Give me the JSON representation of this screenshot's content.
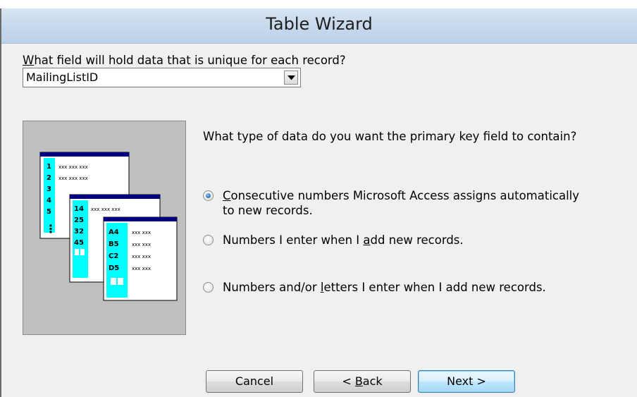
{
  "window": {
    "title": "Table Wizard"
  },
  "unique_field": {
    "question_prefix": "W",
    "question_rest": "hat field will hold data that is unique for each record?",
    "selected_value": "MailingListID"
  },
  "primary_key": {
    "question": "What type of data do you want the primary key field to contain?",
    "options": [
      {
        "label_prefix": "",
        "label_access": "C",
        "label_rest": "onsecutive numbers Microsoft Access assigns automatically",
        "label_line2": "to new records.",
        "checked": true
      },
      {
        "label_prefix": "Numbers I enter when I ",
        "label_access": "a",
        "label_rest": "dd new records.",
        "label_line2": "",
        "checked": false
      },
      {
        "label_prefix": "Numbers and/or ",
        "label_access": "l",
        "label_rest": "etters I enter when I add new records.",
        "label_line2": "",
        "checked": false
      }
    ]
  },
  "illustration": {
    "table1_rows": [
      "1",
      "2",
      "3",
      "4",
      "5"
    ],
    "table1_cells": "xxx xxx xxx",
    "table2_rows": [
      "14",
      "25",
      "32",
      "45"
    ],
    "table2_cells": "xxx xxx xxx",
    "table3_rows": [
      "A4",
      "B5",
      "C2",
      "D5"
    ],
    "table3_cells": "xxx xxx",
    "ellipsis": "⋮"
  },
  "buttons": {
    "cancel": "Cancel",
    "back_prefix": "< ",
    "back_access": "B",
    "back_rest": "ack",
    "next": "Next >"
  },
  "colors": {
    "accent_cyan": "#00ffff",
    "table_header": "#000080",
    "title_bar": "#c6d8ec"
  }
}
